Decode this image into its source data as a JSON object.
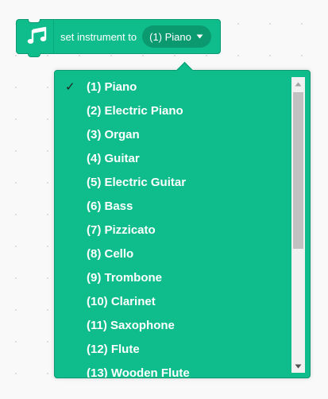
{
  "block": {
    "icon": "music-notes-icon",
    "label": "set instrument to",
    "selected_value": "(1) Piano",
    "caret_icon": "caret-down-icon"
  },
  "menu": {
    "checked_index": 0,
    "check_mark": "✓",
    "items": [
      "(1) Piano",
      "(2) Electric Piano",
      "(3) Organ",
      "(4) Guitar",
      "(5) Electric Guitar",
      "(6) Bass",
      "(7) Pizzicato",
      "(8) Cello",
      "(9) Trombone",
      "(10) Clarinet",
      "(11) Saxophone",
      "(12) Flute",
      "(13) Wooden Flute"
    ],
    "scroll_position": 0.0
  },
  "colors": {
    "block_green": "#0fbd8c",
    "block_border": "#0b9a70",
    "text": "#ffffff",
    "check": "#1f1f1f",
    "scroll_track": "#f1f1f1",
    "scroll_thumb": "#c1c1c1"
  }
}
